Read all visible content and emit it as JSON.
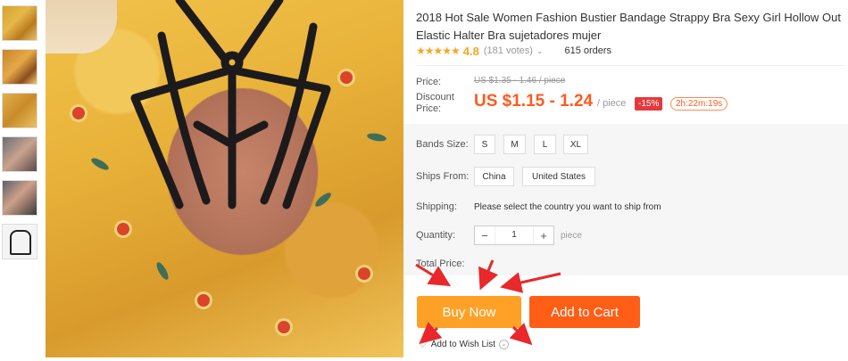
{
  "product": {
    "title": "2018 Hot Sale Women Fashion Bustier Bandage Strappy Bra Sexy Girl Hollow Out Elastic Halter Bra sujetadores mujer",
    "rating": {
      "stars": "★★★★★",
      "value": "4.8",
      "votes": "(181 votes)",
      "orders": "615 orders",
      "stars_filled_fraction": 0.96
    }
  },
  "price": {
    "price_label": "Price:",
    "original": "US $1.35 - 1.46 / piece",
    "discount_label": "Discount Price:",
    "sale": "US $1.15 - 1.24",
    "per_piece": "/ piece",
    "discount_badge": "-15%",
    "timer": "2h:22m:19s"
  },
  "options": {
    "bands_label": "Bands Size:",
    "sizes": [
      "S",
      "M",
      "L",
      "XL"
    ],
    "ships_label": "Ships From:",
    "ships_from": [
      "China",
      "United States"
    ],
    "shipping_label": "Shipping:",
    "shipping_message": "Please select the country you want to ship from",
    "quantity_label": "Quantity:",
    "quantity_value": "1",
    "quantity_unit": "piece",
    "total_label": "Total Price:"
  },
  "actions": {
    "buy_now": "Buy Now",
    "add_to_cart": "Add to Cart",
    "wish_list": "Add to Wish List"
  },
  "colors": {
    "sale_orange": "#ff5a1f",
    "buy_now": "#ffa127",
    "add_to_cart": "#ff5e17",
    "discount_red": "#e4393c",
    "annotation_arrow": "#e8282b"
  },
  "icons": {
    "rating": "star-icon",
    "wish": "heart-icon",
    "minus": "minus-icon",
    "plus": "plus-icon"
  }
}
